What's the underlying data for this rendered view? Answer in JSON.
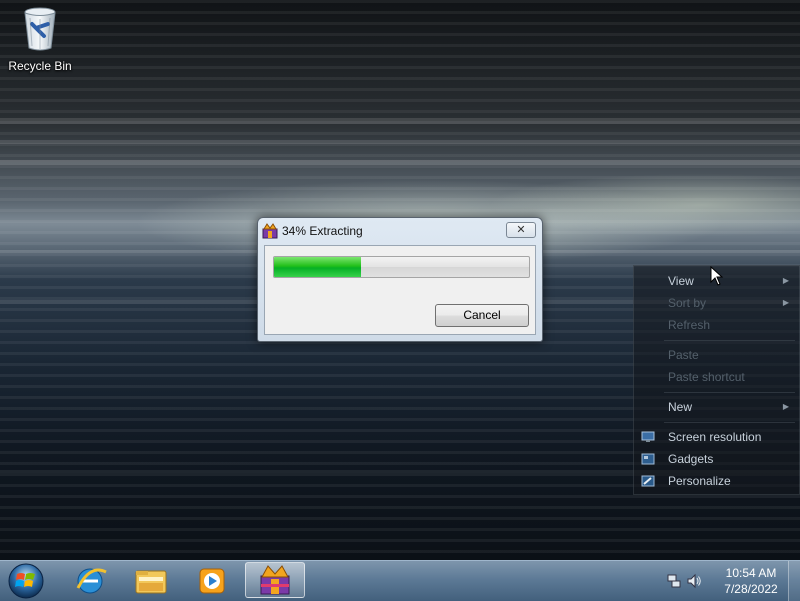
{
  "desktop": {
    "icons": [
      {
        "label": "Recycle Bin",
        "icon": "recycle-bin-icon"
      }
    ]
  },
  "dialog": {
    "title": "34% Extracting",
    "progress_percent": 34,
    "cancel_label": "Cancel",
    "close_symbol": "✕"
  },
  "context_menu": {
    "items": [
      {
        "label": "View",
        "submenu": true
      },
      {
        "label": "Sort by",
        "submenu": true
      },
      {
        "label": "Refresh"
      },
      {
        "label": "Paste"
      },
      {
        "label": "Paste shortcut"
      },
      {
        "label": "New",
        "submenu": true
      },
      {
        "label": "Screen resolution",
        "icon": "screen-resolution-icon"
      },
      {
        "label": "Gadgets",
        "icon": "gadgets-icon"
      },
      {
        "label": "Personalize",
        "icon": "personalize-icon"
      }
    ],
    "submenu_arrow": "▶"
  },
  "taskbar": {
    "pinned": [
      {
        "name": "internet-explorer-icon"
      },
      {
        "name": "windows-explorer-icon"
      },
      {
        "name": "windows-media-player-icon"
      },
      {
        "name": "extractor-app-icon",
        "active": true
      }
    ],
    "clock": {
      "time": "10:54 AM",
      "date": "7/28/2022"
    }
  },
  "colors": {
    "progress_green": "#06b025",
    "taskbar": "#3c5872",
    "dialog_frame": "#cfdbe8"
  }
}
